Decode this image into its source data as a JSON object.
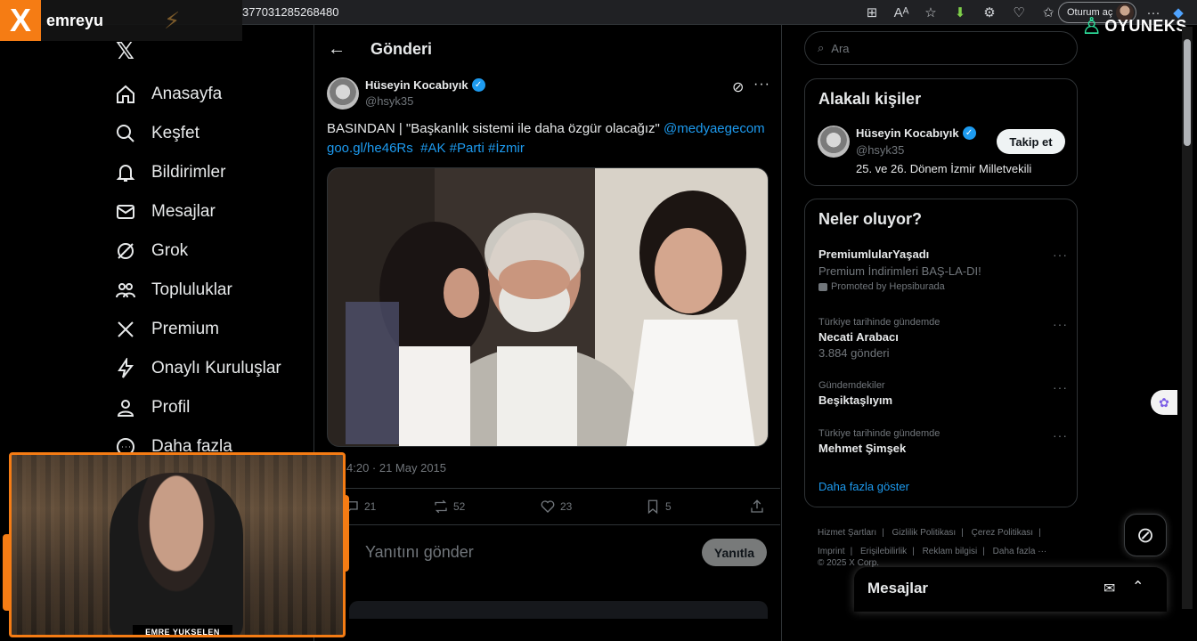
{
  "browser": {
    "url_fragment": "377031285268480",
    "signin_label": "Oturum aç"
  },
  "overlay": {
    "stream_logo": "X",
    "stream_name": "emreyu",
    "brand_logo_text": "OYUNEKS",
    "webcam_name": "EMRE YUKSELEN"
  },
  "nav": {
    "items": [
      {
        "label": "Anasayfa",
        "icon": "home-icon"
      },
      {
        "label": "Keşfet",
        "icon": "search-icon"
      },
      {
        "label": "Bildirimler",
        "icon": "bell-icon"
      },
      {
        "label": "Mesajlar",
        "icon": "mail-icon"
      },
      {
        "label": "Grok",
        "icon": "grok-icon"
      },
      {
        "label": "Topluluklar",
        "icon": "people-icon"
      },
      {
        "label": "Premium",
        "icon": "x-icon"
      },
      {
        "label": "Onaylı Kuruluşlar",
        "icon": "lightning-icon"
      },
      {
        "label": "Profil",
        "icon": "user-icon"
      },
      {
        "label": "Daha fazla",
        "icon": "more-circle-icon"
      }
    ]
  },
  "post": {
    "header_title": "Gönderi",
    "author_name": "Hüseyin Kocabıyık",
    "author_handle": "@hsyk35",
    "text_main": "BASINDAN | \"Başkanlık sistemi ile daha özgür olacağız\" ",
    "mention": "@medyaegecom",
    "link": "goo.gl/he46Rs",
    "hashtags": [
      "#AK",
      "#Parti",
      "#İzmir"
    ],
    "timestamp": "4:20 · 21 May 2015",
    "stats": {
      "replies": "21",
      "reposts": "52",
      "likes": "23",
      "bookmarks": "5"
    },
    "reply_placeholder": "Yanıtını gönder",
    "reply_button": "Yanıtla"
  },
  "sidebar": {
    "search_placeholder": "Ara",
    "related_title": "Alakalı kişiler",
    "related_person": {
      "name": "Hüseyin Kocabıyık",
      "handle": "@hsyk35",
      "bio": "25. ve 26. Dönem İzmir Milletvekili",
      "follow_label": "Takip et"
    },
    "trends_title": "Neler oluyor?",
    "promo": {
      "name": "PremiumlularYaşadı",
      "desc": "Premium İndirimleri BAŞ-LA-DI!",
      "by": "Promoted by Hepsiburada"
    },
    "trends": [
      {
        "context": "Türkiye tarihinde gündemde",
        "name": "Necati Arabacı",
        "sub": "3.884 gönderi"
      },
      {
        "context": "Gündemdekiler",
        "name": "Beşiktaşlıyım",
        "sub": ""
      },
      {
        "context": "Türkiye tarihinde gündemde",
        "name": "Mehmet Şimşek",
        "sub": ""
      }
    ],
    "show_more": "Daha fazla göster",
    "footer": [
      "Hizmet Şartları",
      "|",
      "Gizlilik Politikası",
      "|",
      "Çerez Politikası",
      "|",
      "Imprint",
      "|",
      "Erişilebilirlik",
      "|",
      "Reklam bilgisi",
      "|",
      "Daha fazla ···",
      "© 2025 X Corp."
    ]
  },
  "messages_drawer": {
    "title": "Mesajlar"
  },
  "colors": {
    "accent": "#1d9bf0",
    "stream_orange": "#f57c14",
    "oyuneks_green": "#2ee6a0"
  }
}
